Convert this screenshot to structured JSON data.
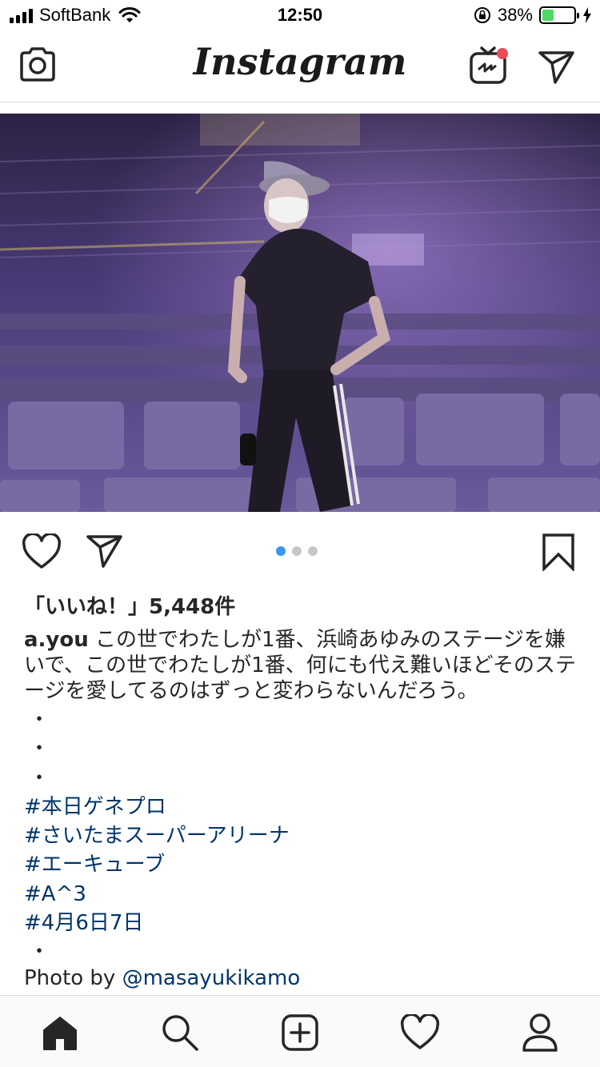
{
  "status_bar": {
    "carrier": "SoftBank",
    "time": "12:50",
    "battery_percent": "38%",
    "battery_level": 0.38,
    "battery_color": "#4cd964"
  },
  "top_nav": {
    "logo": "Instagram",
    "left_icon": "camera-icon",
    "right_icons": [
      "igtv-icon",
      "direct-message-icon"
    ],
    "igtv_badge_color": "#ed4956"
  },
  "post": {
    "carousel": {
      "count": 3,
      "active_index": 0,
      "active_color": "#3897f0"
    },
    "likes": "「いいね！」5,448件",
    "caption": {
      "username": "a.you",
      "text": "この世でわたしが1番、浜崎あゆみのステージを嫌いで、この世でわたしが1番、何にも代え難いほどそのステージを愛してるのはずっと変わらないんだろう。"
    },
    "dot_lines": [
      "・",
      "・",
      "・"
    ],
    "hashtags": [
      "#本日ゲネプロ",
      "#さいたまスーパーアリーナ",
      "#エーキューブ",
      "#A^3",
      "#4月6日7日"
    ],
    "trailing_dot": "・",
    "credit": {
      "prefix": "Photo by ",
      "mention": "@masayukikamo"
    },
    "link_color": "#003569"
  },
  "tab_bar": {
    "tabs": [
      "home-icon",
      "search-icon",
      "new-post-icon",
      "activity-heart-icon",
      "profile-icon"
    ]
  }
}
